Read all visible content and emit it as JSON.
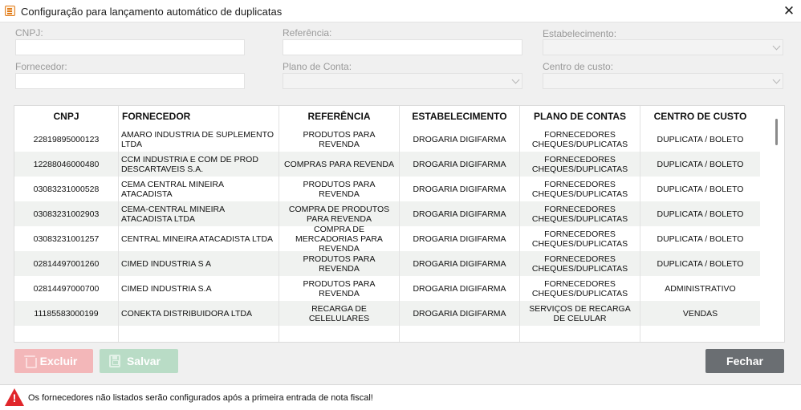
{
  "window": {
    "title": "Configuração para lançamento automático de duplicatas",
    "close_glyph": "✕"
  },
  "filters": {
    "cnpj_label": "CNPJ:",
    "cnpj_value": "",
    "referencia_label": "Referência:",
    "referencia_value": "",
    "estabelecimento_label": "Estabelecimento:",
    "estabelecimento_value": "",
    "fornecedor_label": "Fornecedor:",
    "fornecedor_value": "",
    "plano_label": "Plano de Conta:",
    "plano_value": "",
    "centro_label": "Centro de custo:",
    "centro_value": ""
  },
  "table": {
    "columns": [
      "CNPJ",
      "FORNECEDOR",
      "REFERÊNCIA",
      "ESTABELECIMENTO",
      "PLANO DE CONTAS",
      "CENTRO DE CUSTO"
    ],
    "rows": [
      [
        "22819895000123",
        "AMARO INDUSTRIA DE SUPLEMENTO LTDA",
        "PRODUTOS PARA REVENDA",
        "DROGARIA DIGIFARMA",
        "FORNECEDORES CHEQUES/DUPLICATAS",
        "DUPLICATA / BOLETO"
      ],
      [
        "12288046000480",
        "CCM INDUSTRIA E COM DE PROD DESCARTAVEIS S.A.",
        "COMPRAS PARA REVENDA",
        "DROGARIA DIGIFARMA",
        "FORNECEDORES CHEQUES/DUPLICATAS",
        "DUPLICATA / BOLETO"
      ],
      [
        "03083231000528",
        "CEMA CENTRAL MINEIRA ATACADISTA",
        "PRODUTOS PARA REVENDA",
        "DROGARIA DIGIFARMA",
        "FORNECEDORES CHEQUES/DUPLICATAS",
        "DUPLICATA / BOLETO"
      ],
      [
        "03083231002903",
        "CEMA-CENTRAL MINEIRA ATACADISTA LTDA",
        "COMPRA DE PRODUTOS PARA REVENDA",
        "DROGARIA DIGIFARMA",
        "FORNECEDORES CHEQUES/DUPLICATAS",
        "DUPLICATA / BOLETO"
      ],
      [
        "03083231001257",
        "CENTRAL MINEIRA ATACADISTA LTDA",
        "COMPRA DE MERCADORIAS PARA REVENDA",
        "DROGARIA DIGIFARMA",
        "FORNECEDORES CHEQUES/DUPLICATAS",
        "DUPLICATA / BOLETO"
      ],
      [
        "02814497001260",
        "CIMED INDUSTRIA S A",
        "PRODUTOS PARA REVENDA",
        "DROGARIA DIGIFARMA",
        "FORNECEDORES CHEQUES/DUPLICATAS",
        "DUPLICATA / BOLETO"
      ],
      [
        "02814497000700",
        "CIMED INDUSTRIA S.A",
        "PRODUTOS PARA REVENDA",
        "DROGARIA DIGIFARMA",
        "FORNECEDORES CHEQUES/DUPLICATAS",
        "ADMINISTRATIVO"
      ],
      [
        "11185583000199",
        "CONEKTA DISTRIBUIDORA LTDA",
        "RECARGA DE CELELULARES",
        "DROGARIA DIGIFARMA",
        "SERVIÇOS DE RECARGA DE CELULAR",
        "VENDAS"
      ]
    ]
  },
  "buttons": {
    "excluir": "Excluir",
    "salvar": "Salvar",
    "fechar": "Fechar"
  },
  "status": {
    "message": "Os fornecedores não listados serão configurados após a primeira entrada de nota fiscal!",
    "icon_glyph": "!"
  },
  "colors": {
    "excluir_bg": "#f3b7b9",
    "salvar_bg": "#b9dcc6",
    "fechar_bg": "#6a6e72",
    "warning": "#e0262b"
  }
}
